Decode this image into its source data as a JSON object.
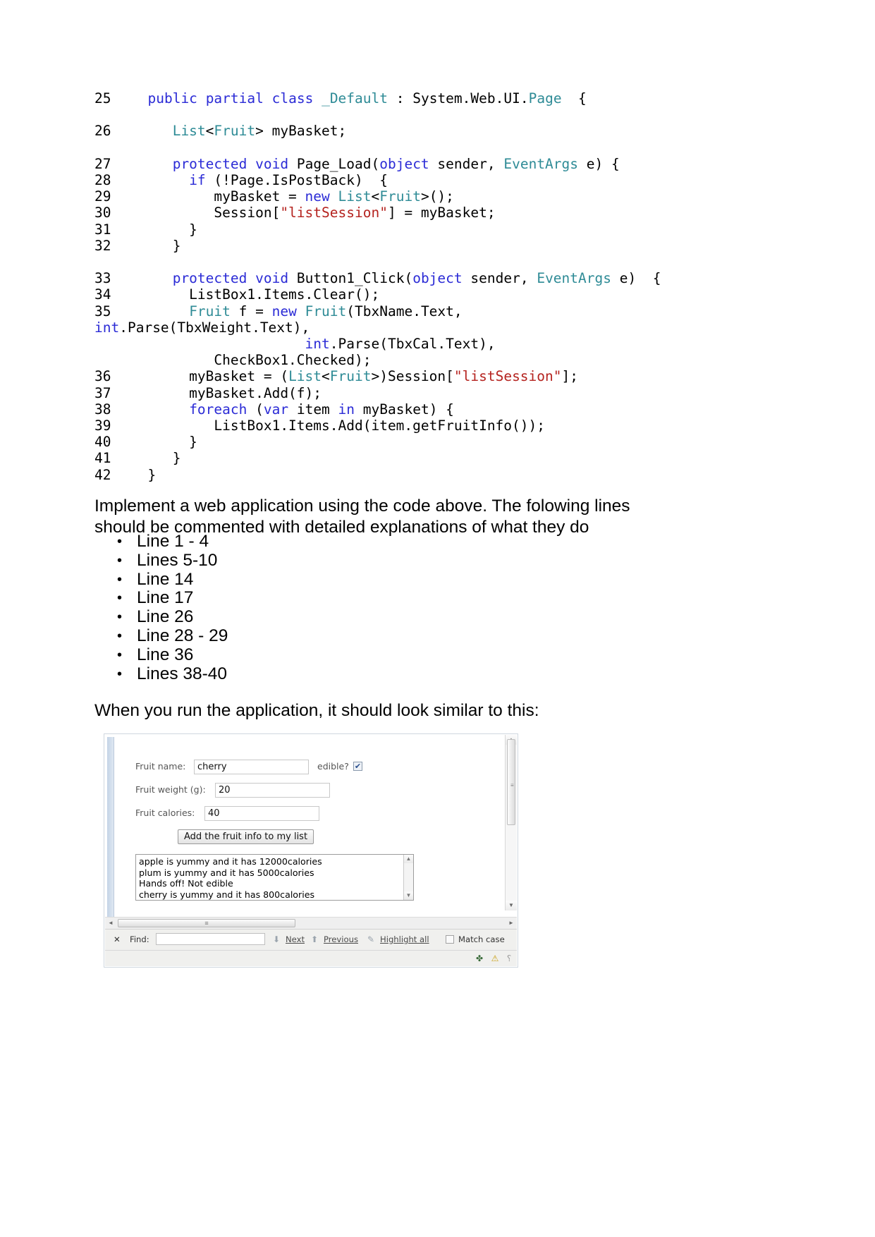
{
  "code": {
    "lines": [
      {
        "num": "25",
        "indent": 0,
        "tokens": [
          {
            "t": "  ",
            "c": "pl"
          },
          {
            "t": "public",
            "c": "kw"
          },
          {
            "t": " ",
            "c": "pl"
          },
          {
            "t": "partial",
            "c": "kw"
          },
          {
            "t": " ",
            "c": "pl"
          },
          {
            "t": "class",
            "c": "kw"
          },
          {
            "t": " ",
            "c": "pl"
          },
          {
            "t": "_Default",
            "c": "ty"
          },
          {
            "t": " : System.Web.UI.",
            "c": "pl"
          },
          {
            "t": "Page",
            "c": "ty"
          },
          {
            "t": "  {",
            "c": "pl"
          }
        ]
      },
      {
        "num": "",
        "blank": true
      },
      {
        "num": "26",
        "tokens": [
          {
            "t": "     ",
            "c": "pl"
          },
          {
            "t": "List",
            "c": "ty"
          },
          {
            "t": "<",
            "c": "pl"
          },
          {
            "t": "Fruit",
            "c": "ty"
          },
          {
            "t": "> myBasket;",
            "c": "pl"
          }
        ]
      },
      {
        "num": "",
        "blank": true
      },
      {
        "num": "27",
        "tokens": [
          {
            "t": "     ",
            "c": "pl"
          },
          {
            "t": "protected",
            "c": "kw"
          },
          {
            "t": " ",
            "c": "pl"
          },
          {
            "t": "void",
            "c": "kw"
          },
          {
            "t": " Page_Load(",
            "c": "pl"
          },
          {
            "t": "object",
            "c": "kw"
          },
          {
            "t": " sender, ",
            "c": "pl"
          },
          {
            "t": "EventArgs",
            "c": "ty"
          },
          {
            "t": " e) {",
            "c": "pl"
          }
        ]
      },
      {
        "num": "28",
        "tokens": [
          {
            "t": "       ",
            "c": "pl"
          },
          {
            "t": "if",
            "c": "kw"
          },
          {
            "t": " (!Page.IsPostBack)  {",
            "c": "pl"
          }
        ]
      },
      {
        "num": "29",
        "tokens": [
          {
            "t": "          myBasket = ",
            "c": "pl"
          },
          {
            "t": "new",
            "c": "kw"
          },
          {
            "t": " ",
            "c": "pl"
          },
          {
            "t": "List",
            "c": "ty"
          },
          {
            "t": "<",
            "c": "pl"
          },
          {
            "t": "Fruit",
            "c": "ty"
          },
          {
            "t": ">();",
            "c": "pl"
          }
        ]
      },
      {
        "num": "30",
        "tokens": [
          {
            "t": "          Session[",
            "c": "pl"
          },
          {
            "t": "\"listSession\"",
            "c": "st"
          },
          {
            "t": "] = myBasket;",
            "c": "pl"
          }
        ]
      },
      {
        "num": "31",
        "tokens": [
          {
            "t": "       }",
            "c": "pl"
          }
        ]
      },
      {
        "num": "32",
        "tokens": [
          {
            "t": "     }",
            "c": "pl"
          }
        ]
      },
      {
        "num": "",
        "blank": true
      },
      {
        "num": "33",
        "tokens": [
          {
            "t": "     ",
            "c": "pl"
          },
          {
            "t": "protected",
            "c": "kw"
          },
          {
            "t": " ",
            "c": "pl"
          },
          {
            "t": "void",
            "c": "kw"
          },
          {
            "t": " Button1_Click(",
            "c": "pl"
          },
          {
            "t": "object",
            "c": "kw"
          },
          {
            "t": " sender, ",
            "c": "pl"
          },
          {
            "t": "EventArgs",
            "c": "ty"
          },
          {
            "t": " e)  {",
            "c": "pl"
          }
        ]
      },
      {
        "num": "34",
        "tokens": [
          {
            "t": "       ListBox1.Items.Clear();",
            "c": "pl"
          }
        ]
      },
      {
        "num": "35",
        "tokens": [
          {
            "t": "       ",
            "c": "pl"
          },
          {
            "t": "Fruit",
            "c": "ty"
          },
          {
            "t": " f = ",
            "c": "pl"
          },
          {
            "t": "new",
            "c": "kw"
          },
          {
            "t": " ",
            "c": "pl"
          },
          {
            "t": "Fruit",
            "c": "ty"
          },
          {
            "t": "(TbxName.Text,",
            "c": "pl"
          }
        ]
      },
      {
        "num": "",
        "nonum": true,
        "tokens": [
          {
            "t": "int",
            "c": "kw"
          },
          {
            "t": ".Parse(TbxWeight.Text),",
            "c": "pl"
          }
        ],
        "noindent": true
      },
      {
        "num": "",
        "nonum": true,
        "tokens": [
          {
            "t": "                     ",
            "c": "pl"
          },
          {
            "t": "int",
            "c": "kw"
          },
          {
            "t": ".Parse(TbxCal.Text),",
            "c": "pl"
          }
        ]
      },
      {
        "num": "",
        "nonum": true,
        "tokens": [
          {
            "t": "          CheckBox1.Checked);",
            "c": "pl"
          }
        ]
      },
      {
        "num": "36",
        "tokens": [
          {
            "t": "       myBasket = (",
            "c": "pl"
          },
          {
            "t": "List",
            "c": "ty"
          },
          {
            "t": "<",
            "c": "pl"
          },
          {
            "t": "Fruit",
            "c": "ty"
          },
          {
            "t": ">)Session[",
            "c": "pl"
          },
          {
            "t": "\"listSession\"",
            "c": "st"
          },
          {
            "t": "];",
            "c": "pl"
          }
        ]
      },
      {
        "num": "37",
        "tokens": [
          {
            "t": "       myBasket.Add(f);",
            "c": "pl"
          }
        ]
      },
      {
        "num": "38",
        "tokens": [
          {
            "t": "       ",
            "c": "pl"
          },
          {
            "t": "foreach",
            "c": "kw"
          },
          {
            "t": " (",
            "c": "pl"
          },
          {
            "t": "var",
            "c": "kw"
          },
          {
            "t": " item ",
            "c": "pl"
          },
          {
            "t": "in",
            "c": "kw"
          },
          {
            "t": " myBasket) {",
            "c": "pl"
          }
        ]
      },
      {
        "num": "39",
        "tokens": [
          {
            "t": "          ListBox1.Items.Add(item.getFruitInfo());",
            "c": "pl"
          }
        ]
      },
      {
        "num": "40",
        "tokens": [
          {
            "t": "       }",
            "c": "pl"
          }
        ]
      },
      {
        "num": "41",
        "tokens": [
          {
            "t": "     }",
            "c": "pl"
          }
        ]
      },
      {
        "num": "42",
        "tokens": [
          {
            "t": "  }",
            "c": "pl"
          }
        ]
      }
    ]
  },
  "instructions": {
    "paragraph": "Implement a web application  using the code above. The folowing lines should be commented with detailed explanations of what they do",
    "bullets": [
      "Line 1 - 4",
      "Lines 5-10",
      "Line 14",
      "Line 17",
      "Line 26",
      "Line 28 - 29",
      "Line 36",
      "Lines 38-40"
    ],
    "bullet_glyph": "•",
    "run_note": "When you run the application, it  should look similar to this:"
  },
  "screenshot": {
    "form": {
      "rows": [
        {
          "label": "Fruit name:",
          "value": "cherry"
        },
        {
          "label": "Fruit weight (g):",
          "value": "20"
        },
        {
          "label": "Fruit calories:",
          "value": "40"
        }
      ],
      "edible_label": "edible?",
      "edible_checked_glyph": "✔",
      "button_label": "Add the fruit info to my list"
    },
    "listbox": {
      "items": [
        "apple is yummy and it has 12000calories",
        "plum is yummy and it has 5000calories",
        "Hands off! Not edible",
        "cherry is yummy and it has 800calories"
      ],
      "scroll_up_glyph": "▲",
      "scroll_down_glyph": "▼"
    },
    "page_scrollbar": {
      "up_glyph": "▲",
      "down_glyph": "▼",
      "grip_glyph": "≡"
    },
    "hscrollbar": {
      "left_glyph": "◄",
      "right_glyph": "►",
      "grip_glyph": "≡"
    },
    "findbar": {
      "close_glyph": "✕",
      "find_label": "Find:",
      "find_value": "",
      "next_label": "Next",
      "next_glyph": "⬇",
      "previous_label": "Previous",
      "previous_glyph": "⬆",
      "highlight_label": "Highlight all",
      "highlight_glyph": "✎",
      "match_case_label": "Match case"
    },
    "statusbar": {
      "bug_glyph": "✤",
      "warn_glyph": "⚠",
      "resize_glyph": "⸮"
    }
  }
}
